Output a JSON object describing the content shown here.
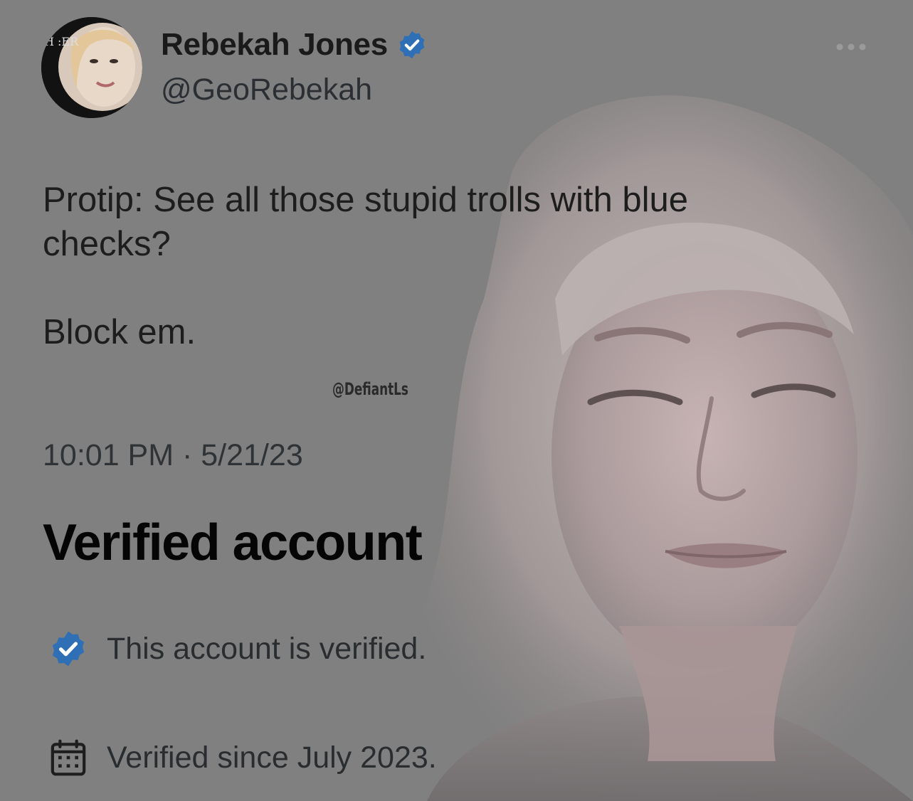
{
  "tweet": {
    "author": {
      "display_name": "Rebekah Jones",
      "handle": "@GeoRebekah",
      "avatar_text": "H :ER"
    },
    "text": "Protip: See all those stupid trolls with blue\nchecks?\n\nBlock em.",
    "timestamp": "10:01 PM · 5/21/23"
  },
  "watermark": "@DefiantLs",
  "verified_panel": {
    "title": "Verified account",
    "rows": [
      {
        "icon": "verified-badge-icon",
        "text": "This account is verified."
      },
      {
        "icon": "calendar-icon",
        "text": "Verified since July 2023."
      }
    ]
  },
  "colors": {
    "background": "#808080",
    "badge_blue": "#2f6fb5",
    "text_dark": "#1d1d1d"
  }
}
